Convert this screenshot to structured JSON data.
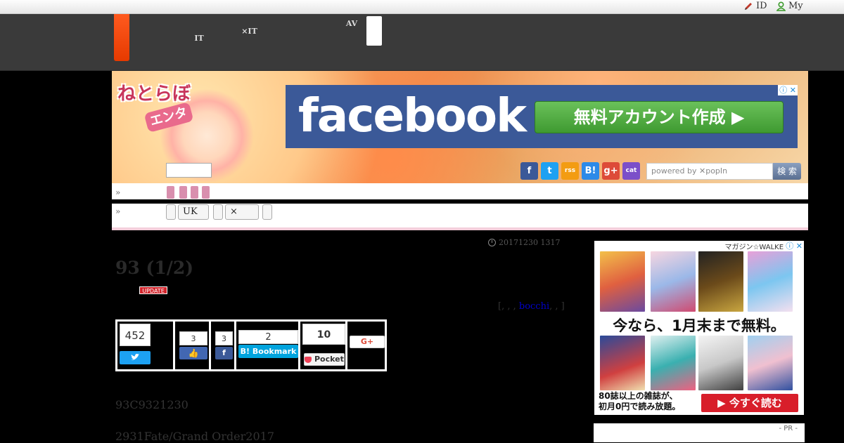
{
  "topbar": {
    "id_label": "ID",
    "my_label": "My"
  },
  "nav": {
    "items": [
      {
        "line1": "　　",
        "line2": "IT"
      },
      {
        "line1": "　　　",
        "line2": "×IT"
      },
      {
        "line1": "AV",
        "line2": "　　"
      }
    ]
  },
  "banner": {
    "logo_text": "ねとらぼ",
    "logo_sub": "エンタ",
    "ad": {
      "brand": "facebook",
      "cta": "無料アカウント作成 ▶",
      "adchoices": "ⓘ ✕"
    },
    "social": [
      "f",
      "t",
      "rss",
      "B!",
      "g+",
      "cat"
    ],
    "search_placeholder": "powered by ✕popIn",
    "search_button": "検 索"
  },
  "breadcrumbs": {
    "row1_marker": "»",
    "row2_marker": "»",
    "row2_tags": [
      "",
      "UK",
      "",
      "×",
      ""
    ]
  },
  "article": {
    "date": "20171230 1317",
    "title": "93 (1/2)",
    "badge": "UPDATE",
    "tags_prefix": "[, , , ",
    "tags_link": "bocchi",
    "tags_suffix": ", , ]",
    "paragraphs": [
      "93C9321230",
      "2931Fate/Grand Order2017"
    ]
  },
  "share": {
    "twitter_count": "452",
    "facebook_like_count": "3",
    "facebook_share_count": "3",
    "hatena_count": "2",
    "hatena_label": "B! Bookmark",
    "pocket_count": "10",
    "pocket_label": "Pocket",
    "gplus_label": "G+"
  },
  "sidebar": {
    "ad": {
      "brand": "マガジン☆WALKER",
      "promo": "今なら、1月末まで無料。",
      "small_line1": "80誌以上の雑誌が、",
      "small_line2": "初月0円で読み放題。",
      "cta": "今すぐ読む"
    },
    "pr_label": "- PR -"
  },
  "colors": {
    "nav_bg": "#3a3a3a",
    "logo_accent": "#ff5a1f",
    "facebook": "#3b5998",
    "cta_red": "#d81e2a"
  }
}
